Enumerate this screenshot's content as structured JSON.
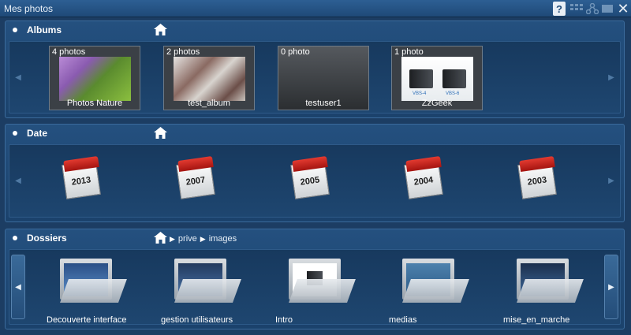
{
  "window": {
    "title": "Mes photos",
    "help_label": "?",
    "close_label": "✕"
  },
  "albums": {
    "title": "Albums",
    "items": [
      {
        "count": "4 photos",
        "name": "Photos Nature"
      },
      {
        "count": "2 photos",
        "name": "test_album"
      },
      {
        "count": "0 photo",
        "name": "testuser1"
      },
      {
        "count": "1 photo",
        "name": "ZzGeek"
      }
    ],
    "server_labels": [
      "VBS-4",
      "VBS-6"
    ]
  },
  "date": {
    "title": "Date",
    "years": [
      "2013",
      "2007",
      "2005",
      "2004",
      "2003"
    ]
  },
  "dossiers": {
    "title": "Dossiers",
    "breadcrumb": [
      "prive",
      "images"
    ],
    "folders": [
      {
        "name": "Decouverte interface"
      },
      {
        "name": "gestion utilisateurs"
      },
      {
        "name": "Intro"
      },
      {
        "name": "medias"
      },
      {
        "name": "mise_en_marche"
      }
    ]
  },
  "colors": {
    "background": "#1c3d63",
    "section": "#24507f",
    "calendar_red": "#e23a30"
  }
}
